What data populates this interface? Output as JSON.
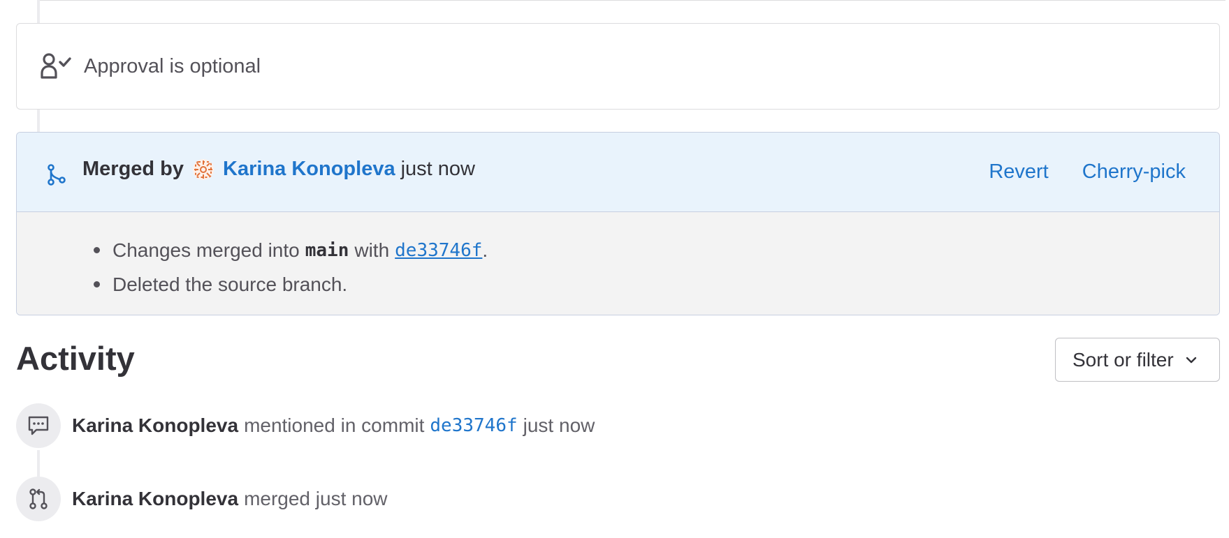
{
  "approval": {
    "icon": "approval-check-icon",
    "text": "Approval is optional"
  },
  "merged": {
    "icon": "merge-icon",
    "label": "Merged by",
    "avatar": "user-avatar",
    "user": "Karina Konopleva",
    "time": "just now",
    "actions": {
      "revert": "Revert",
      "cherry_pick": "Cherry-pick"
    },
    "details": {
      "line1_prefix": "Changes merged into",
      "branch": "main",
      "line1_with": "with",
      "commit_sha": "de33746f",
      "line1_suffix": ".",
      "line2": "Deleted the source branch."
    }
  },
  "activity": {
    "title": "Activity",
    "sort_filter_label": "Sort or filter",
    "items": [
      {
        "icon": "comment-icon",
        "user": "Karina Konopleva",
        "text": "mentioned in commit",
        "sha": "de33746f",
        "time": "just now"
      },
      {
        "icon": "merge-request-icon",
        "user": "Karina Konopleva",
        "text": "merged just now"
      }
    ]
  },
  "colors": {
    "link": "#1f75cb",
    "merged_header_bg": "#e9f3fc",
    "merged_body_bg": "#f3f3f3",
    "avatar_accent": "#e2733b"
  }
}
